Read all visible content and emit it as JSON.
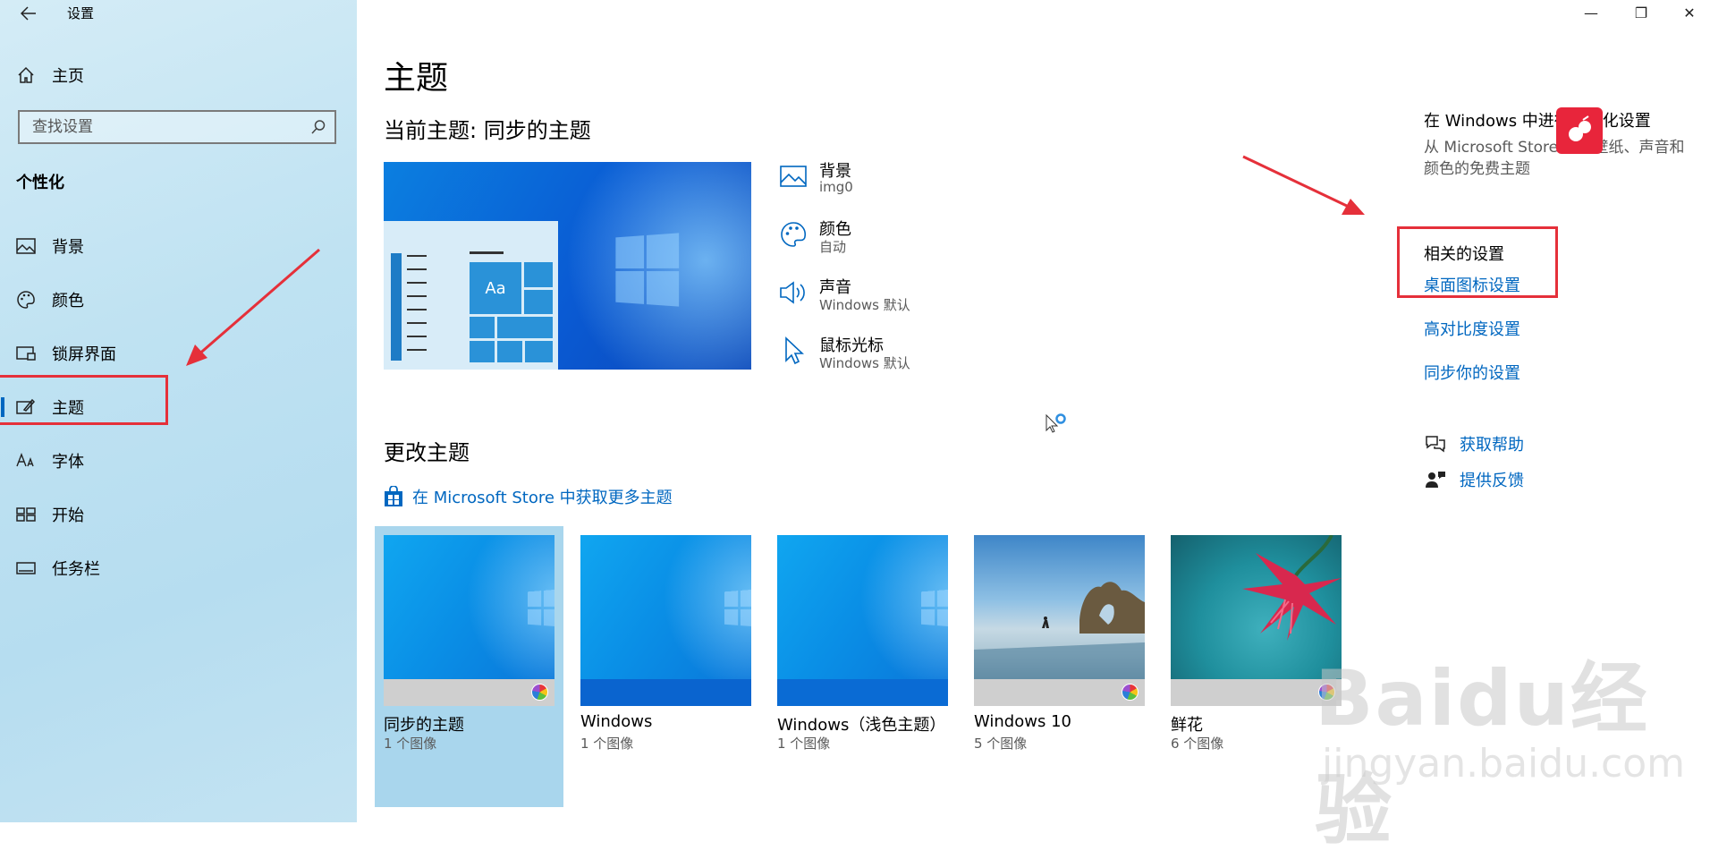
{
  "window": {
    "title": "设置",
    "minimize": "—",
    "maximize": "❐",
    "close": "✕"
  },
  "sidebar": {
    "home": "主页",
    "search_placeholder": "查找设置",
    "section": "个性化",
    "items": [
      {
        "label": "背景"
      },
      {
        "label": "颜色"
      },
      {
        "label": "锁屏界面"
      },
      {
        "label": "主题",
        "selected": true
      },
      {
        "label": "字体"
      },
      {
        "label": "开始"
      },
      {
        "label": "任务栏"
      }
    ]
  },
  "main": {
    "title": "主题",
    "current_theme": "当前主题: 同步的主题",
    "preview_text": "Aa",
    "props": [
      {
        "label": "背景",
        "value": "img0"
      },
      {
        "label": "颜色",
        "value": "自动"
      },
      {
        "label": "声音",
        "value": "Windows 默认"
      },
      {
        "label": "鼠标光标",
        "value": "Windows 默认"
      }
    ],
    "change_theme": "更改主题",
    "store_link": "在 Microsoft Store 中获取更多主题",
    "themes": [
      {
        "name": "同步的主题",
        "count": "1 个图像",
        "selected": true
      },
      {
        "name": "Windows",
        "count": "1 个图像"
      },
      {
        "name": "Windows（浅色主题）",
        "count": "1 个图像"
      },
      {
        "name": "Windows 10",
        "count": "5 个图像"
      },
      {
        "name": "鲜花",
        "count": "6 个图像"
      }
    ]
  },
  "right": {
    "promo_title": "在 Windows 中进行个性化设置",
    "promo_desc": "从 Microsoft Store 下载壁纸、声音和颜色的免费主题",
    "related_title": "相关的设置",
    "links": [
      "桌面图标设置",
      "高对比度设置",
      "同步你的设置"
    ],
    "help": "获取帮助",
    "feedback": "提供反馈"
  },
  "watermark": {
    "logo": "Baidu经验",
    "url": "jingyan.baidu.com"
  },
  "colors": {
    "accent": "#0067c0",
    "annotation": "#e5303a",
    "sidebar": "#bfe2f2"
  }
}
